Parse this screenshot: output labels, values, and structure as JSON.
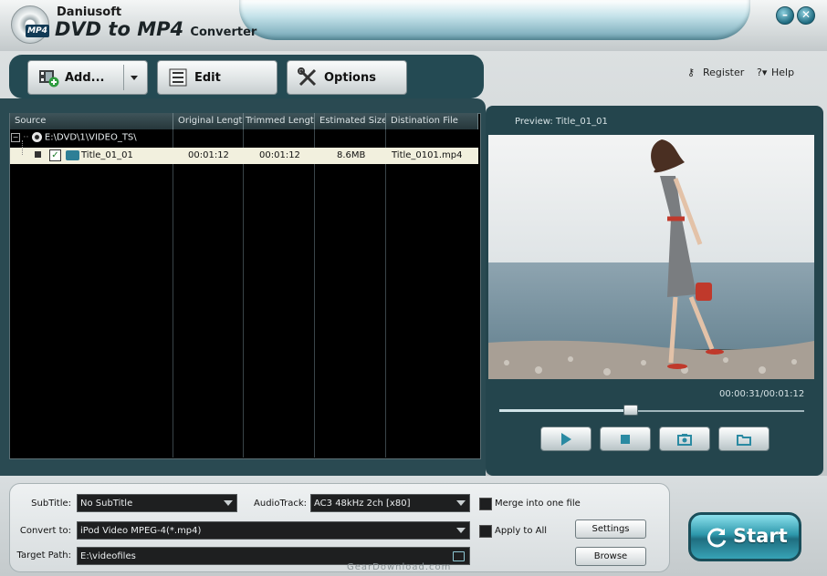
{
  "app": {
    "brand": "Daniusoft",
    "name": "DVD to MP4",
    "suffix": "Converter",
    "logo_badge": "MP4"
  },
  "window_controls": {
    "minimize": "–",
    "close": "✕"
  },
  "toolbar": {
    "add_label": "Add...",
    "edit_label": "Edit",
    "options_label": "Options",
    "register_label": "Register",
    "help_label": "Help"
  },
  "file_list": {
    "columns": [
      "Source",
      "Original Length",
      "Trimmed Length",
      "Estimated Size",
      "Distination File"
    ],
    "root_path": "E:\\DVD\\1\\VIDEO_TS\\",
    "rows": [
      {
        "title": "Title_01_01",
        "original": "00:01:12",
        "trimmed": "00:01:12",
        "size": "8.6MB",
        "dest": "Title_0101.mp4",
        "checked": true
      }
    ]
  },
  "preview": {
    "label": "Preview: Title_01_01",
    "timecode": "00:00:31/00:01:12",
    "progress_fraction": 0.43
  },
  "settings": {
    "subtitle_label": "SubTitle:",
    "subtitle_value": "No SubTitle",
    "audiotrack_label": "AudioTrack:",
    "audiotrack_value": "AC3 48kHz 2ch [x80]",
    "merge_label": "Merge into one file",
    "convert_label": "Convert to:",
    "convert_value": "iPod Video MPEG-4(*.mp4)",
    "apply_all_label": "Apply to All",
    "settings_button": "Settings",
    "target_label": "Target Path:",
    "target_value": "E:\\videofiles",
    "browse_button": "Browse"
  },
  "start_label": "Start",
  "watermark": "GearDownload.com",
  "colors": {
    "panel": "#24454d",
    "accent": "#2d98ab",
    "selected_row": "#f2f0de"
  }
}
